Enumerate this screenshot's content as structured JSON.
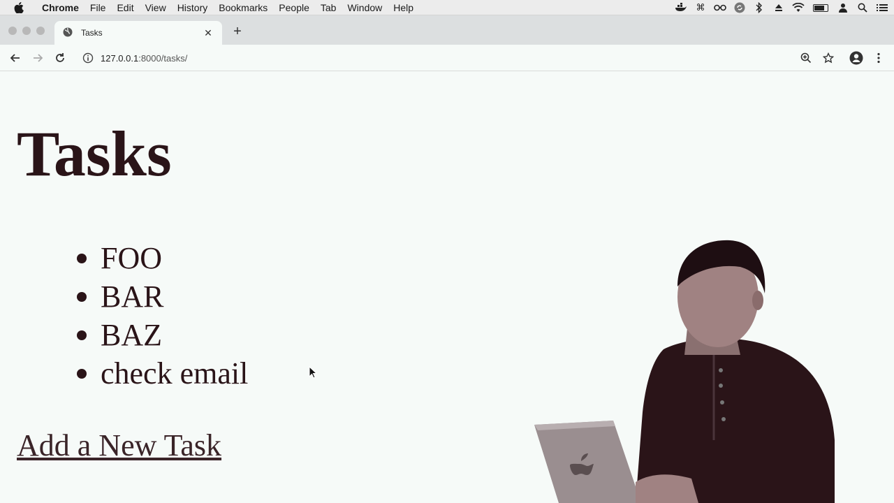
{
  "menubar": {
    "app": "Chrome",
    "items": [
      "File",
      "Edit",
      "View",
      "History",
      "Bookmarks",
      "People",
      "Tab",
      "Window",
      "Help"
    ],
    "status_icons": [
      "docker-icon",
      "command-icon",
      "glasses-icon",
      "sync-icon",
      "bluetooth-icon",
      "eject-icon",
      "wifi-icon",
      "battery-icon",
      "user-icon",
      "spotlight-icon",
      "list-icon"
    ]
  },
  "tab": {
    "title": "Tasks"
  },
  "toolbar": {
    "url_host": "127.0.0.1",
    "url_path": ":8000/tasks/"
  },
  "page": {
    "heading": "Tasks",
    "tasks": [
      "FOO",
      "BAR",
      "BAZ",
      "check email"
    ],
    "add_link": "Add a New Task"
  },
  "colors": {
    "page_bg": "#f6faf8",
    "text": "#2a1418",
    "chrome_bg": "#dcdfe0"
  }
}
